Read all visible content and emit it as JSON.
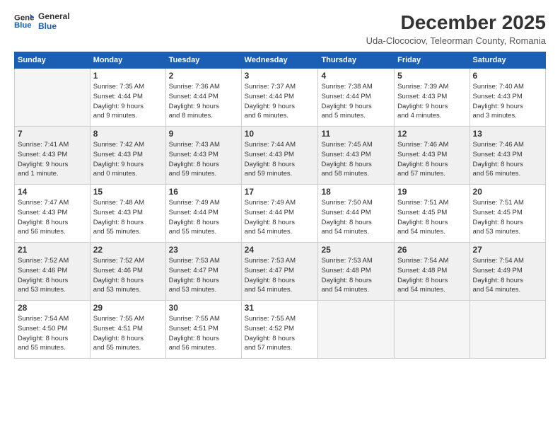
{
  "logo": {
    "line1": "General",
    "line2": "Blue"
  },
  "title": "December 2025",
  "location": "Uda-Clocociov, Teleorman County, Romania",
  "days_of_week": [
    "Sunday",
    "Monday",
    "Tuesday",
    "Wednesday",
    "Thursday",
    "Friday",
    "Saturday"
  ],
  "weeks": [
    [
      {
        "day": "",
        "info": ""
      },
      {
        "day": "1",
        "info": "Sunrise: 7:35 AM\nSunset: 4:44 PM\nDaylight: 9 hours\nand 9 minutes."
      },
      {
        "day": "2",
        "info": "Sunrise: 7:36 AM\nSunset: 4:44 PM\nDaylight: 9 hours\nand 8 minutes."
      },
      {
        "day": "3",
        "info": "Sunrise: 7:37 AM\nSunset: 4:44 PM\nDaylight: 9 hours\nand 6 minutes."
      },
      {
        "day": "4",
        "info": "Sunrise: 7:38 AM\nSunset: 4:44 PM\nDaylight: 9 hours\nand 5 minutes."
      },
      {
        "day": "5",
        "info": "Sunrise: 7:39 AM\nSunset: 4:43 PM\nDaylight: 9 hours\nand 4 minutes."
      },
      {
        "day": "6",
        "info": "Sunrise: 7:40 AM\nSunset: 4:43 PM\nDaylight: 9 hours\nand 3 minutes."
      }
    ],
    [
      {
        "day": "7",
        "info": "Sunrise: 7:41 AM\nSunset: 4:43 PM\nDaylight: 9 hours\nand 1 minute."
      },
      {
        "day": "8",
        "info": "Sunrise: 7:42 AM\nSunset: 4:43 PM\nDaylight: 9 hours\nand 0 minutes."
      },
      {
        "day": "9",
        "info": "Sunrise: 7:43 AM\nSunset: 4:43 PM\nDaylight: 8 hours\nand 59 minutes."
      },
      {
        "day": "10",
        "info": "Sunrise: 7:44 AM\nSunset: 4:43 PM\nDaylight: 8 hours\nand 59 minutes."
      },
      {
        "day": "11",
        "info": "Sunrise: 7:45 AM\nSunset: 4:43 PM\nDaylight: 8 hours\nand 58 minutes."
      },
      {
        "day": "12",
        "info": "Sunrise: 7:46 AM\nSunset: 4:43 PM\nDaylight: 8 hours\nand 57 minutes."
      },
      {
        "day": "13",
        "info": "Sunrise: 7:46 AM\nSunset: 4:43 PM\nDaylight: 8 hours\nand 56 minutes."
      }
    ],
    [
      {
        "day": "14",
        "info": "Sunrise: 7:47 AM\nSunset: 4:43 PM\nDaylight: 8 hours\nand 56 minutes."
      },
      {
        "day": "15",
        "info": "Sunrise: 7:48 AM\nSunset: 4:43 PM\nDaylight: 8 hours\nand 55 minutes."
      },
      {
        "day": "16",
        "info": "Sunrise: 7:49 AM\nSunset: 4:44 PM\nDaylight: 8 hours\nand 55 minutes."
      },
      {
        "day": "17",
        "info": "Sunrise: 7:49 AM\nSunset: 4:44 PM\nDaylight: 8 hours\nand 54 minutes."
      },
      {
        "day": "18",
        "info": "Sunrise: 7:50 AM\nSunset: 4:44 PM\nDaylight: 8 hours\nand 54 minutes."
      },
      {
        "day": "19",
        "info": "Sunrise: 7:51 AM\nSunset: 4:45 PM\nDaylight: 8 hours\nand 54 minutes."
      },
      {
        "day": "20",
        "info": "Sunrise: 7:51 AM\nSunset: 4:45 PM\nDaylight: 8 hours\nand 53 minutes."
      }
    ],
    [
      {
        "day": "21",
        "info": "Sunrise: 7:52 AM\nSunset: 4:46 PM\nDaylight: 8 hours\nand 53 minutes."
      },
      {
        "day": "22",
        "info": "Sunrise: 7:52 AM\nSunset: 4:46 PM\nDaylight: 8 hours\nand 53 minutes."
      },
      {
        "day": "23",
        "info": "Sunrise: 7:53 AM\nSunset: 4:47 PM\nDaylight: 8 hours\nand 53 minutes."
      },
      {
        "day": "24",
        "info": "Sunrise: 7:53 AM\nSunset: 4:47 PM\nDaylight: 8 hours\nand 54 minutes."
      },
      {
        "day": "25",
        "info": "Sunrise: 7:53 AM\nSunset: 4:48 PM\nDaylight: 8 hours\nand 54 minutes."
      },
      {
        "day": "26",
        "info": "Sunrise: 7:54 AM\nSunset: 4:48 PM\nDaylight: 8 hours\nand 54 minutes."
      },
      {
        "day": "27",
        "info": "Sunrise: 7:54 AM\nSunset: 4:49 PM\nDaylight: 8 hours\nand 54 minutes."
      }
    ],
    [
      {
        "day": "28",
        "info": "Sunrise: 7:54 AM\nSunset: 4:50 PM\nDaylight: 8 hours\nand 55 minutes."
      },
      {
        "day": "29",
        "info": "Sunrise: 7:55 AM\nSunset: 4:51 PM\nDaylight: 8 hours\nand 55 minutes."
      },
      {
        "day": "30",
        "info": "Sunrise: 7:55 AM\nSunset: 4:51 PM\nDaylight: 8 hours\nand 56 minutes."
      },
      {
        "day": "31",
        "info": "Sunrise: 7:55 AM\nSunset: 4:52 PM\nDaylight: 8 hours\nand 57 minutes."
      },
      {
        "day": "",
        "info": ""
      },
      {
        "day": "",
        "info": ""
      },
      {
        "day": "",
        "info": ""
      }
    ]
  ]
}
